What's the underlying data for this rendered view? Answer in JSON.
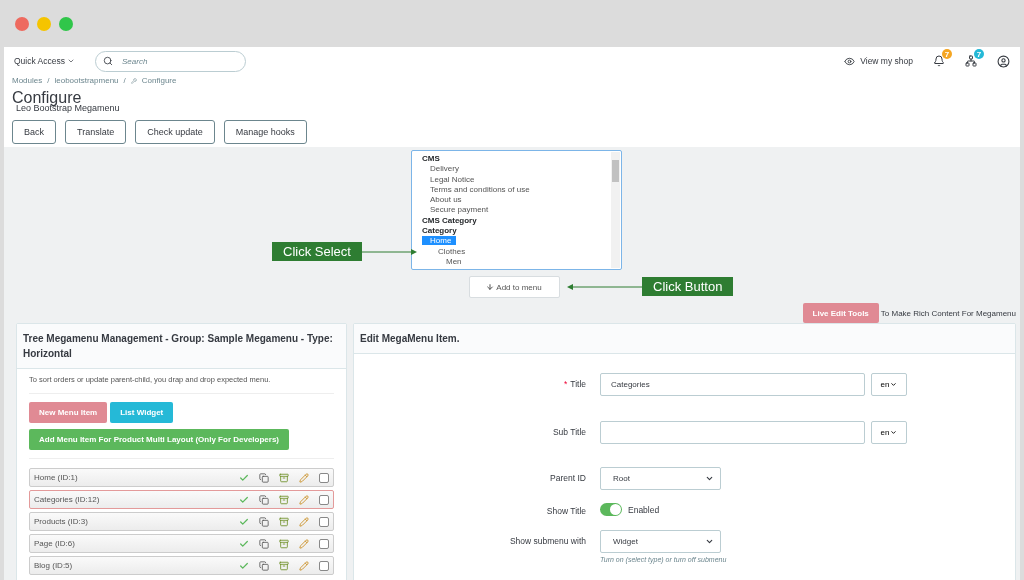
{
  "header": {
    "quick_access": "Quick Access",
    "search": {
      "placeholder": "Search"
    },
    "view_shop": "View my shop",
    "notifications": [
      {
        "kind": "bell",
        "count": "7",
        "color": "#f5a623"
      },
      {
        "kind": "orders",
        "count": "7",
        "color": "#25b9d7"
      }
    ]
  },
  "breadcrumb": {
    "separator": "/",
    "items": [
      "Modules",
      "leobootstrapmenu",
      "Configure"
    ]
  },
  "page": {
    "title": "Configure",
    "subtitle": "Leo Bootstrap Megamenu"
  },
  "toolbar": [
    "Back",
    "Translate",
    "Check update",
    "Manage hooks"
  ],
  "listbox": {
    "options": [
      {
        "label": "CMS",
        "kind": "group",
        "selected": false,
        "children": [
          {
            "label": "Delivery",
            "kind": "item",
            "selected": false
          },
          {
            "label": "Legal Notice",
            "kind": "item",
            "selected": false
          },
          {
            "label": "Terms and conditions of use",
            "kind": "item",
            "selected": false
          },
          {
            "label": "About us",
            "kind": "item",
            "selected": false
          },
          {
            "label": "Secure payment",
            "kind": "item",
            "selected": false
          }
        ]
      },
      {
        "label": "CMS Category",
        "kind": "group",
        "selected": false
      },
      {
        "label": "Category",
        "kind": "group",
        "selected": false,
        "children": [
          {
            "label": "Home",
            "kind": "item",
            "selected": true,
            "children": [
              {
                "label": "Clothes",
                "kind": "item",
                "selected": false,
                "children": [
                  {
                    "label": "Men",
                    "kind": "item",
                    "selected": false
                  }
                ]
              }
            ]
          }
        ]
      }
    ]
  },
  "add_button": "Add to menu",
  "callouts": [
    {
      "kind": "select",
      "label": "Click Select"
    },
    {
      "kind": "button",
      "label": "Click Button"
    }
  ],
  "live_edit": {
    "button": "Live Edit Tools",
    "note": "To Make Rich Content For Megamenu"
  },
  "tree_panel": {
    "title": "Tree Megamenu Management - Group: Sample Megamenu - Type: Horizontal",
    "hint": "To sort orders or update parent-child, you drap and drop expected menu.",
    "buttons": [
      {
        "label": "New Menu Item",
        "kind": "danger"
      },
      {
        "label": "List Widget",
        "kind": "info"
      },
      {
        "label": "Add Menu Item For Product Multi Layout (Only For Developers)",
        "kind": "success"
      }
    ],
    "items": [
      {
        "label": "Home (ID:1)",
        "selected": false,
        "active": true,
        "checked": false
      },
      {
        "label": "Categories (ID:12)",
        "selected": true,
        "active": true,
        "checked": false
      },
      {
        "label": "Products (ID:3)",
        "selected": false,
        "active": true,
        "checked": false
      },
      {
        "label": "Page (ID:6)",
        "selected": false,
        "active": true,
        "checked": false
      },
      {
        "label": "Blog (ID:5)",
        "selected": false,
        "active": true,
        "checked": false
      }
    ]
  },
  "edit_panel": {
    "title": "Edit MegaMenu Item.",
    "fields": [
      {
        "kind": "text",
        "label": "Title",
        "required_mark": "*",
        "value": "Categories",
        "lang": "en"
      },
      {
        "kind": "text",
        "label": "Sub Title",
        "lang": "en"
      },
      {
        "kind": "select",
        "label": "Parent ID",
        "value": "Root"
      },
      {
        "kind": "toggle",
        "label": "Show Title",
        "on": true,
        "state": "Enabled"
      },
      {
        "kind": "select",
        "label": "Show submenu with",
        "value": "Widget",
        "help": "Turn on (select type) or turn off submenu"
      }
    ]
  }
}
